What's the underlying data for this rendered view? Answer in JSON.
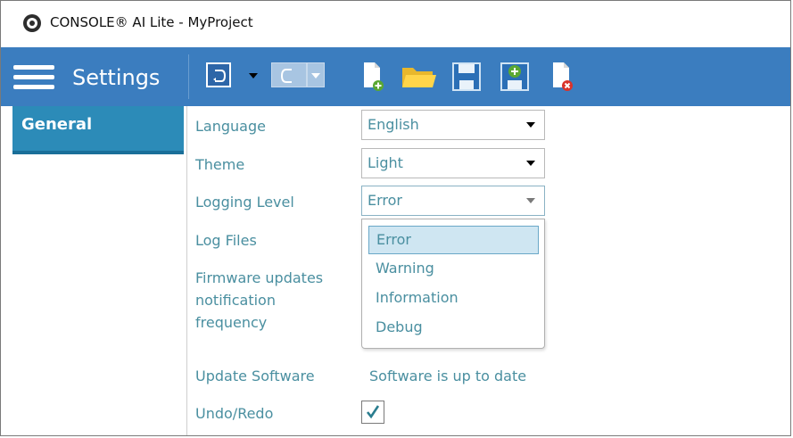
{
  "window": {
    "title": "CONSOLE® AI Lite - MyProject",
    "logo_icon": "app-logo-icon"
  },
  "toolbar": {
    "title": "Settings",
    "background": "#3b7dbf",
    "buttons": [
      {
        "name": "undo",
        "icon": "undo-icon",
        "has_dropdown": true,
        "enabled": true
      },
      {
        "name": "redo",
        "icon": "redo-icon",
        "has_dropdown": true,
        "enabled": false
      },
      {
        "name": "new-file",
        "icon": "new-file-icon"
      },
      {
        "name": "open-folder",
        "icon": "folder-open-icon"
      },
      {
        "name": "save",
        "icon": "save-icon"
      },
      {
        "name": "save-as",
        "icon": "save-as-icon"
      },
      {
        "name": "close-file",
        "icon": "close-file-icon"
      }
    ]
  },
  "sidebar": {
    "items": [
      {
        "label": "General",
        "selected": true
      }
    ]
  },
  "settings": {
    "language": {
      "label": "Language",
      "value": "English"
    },
    "theme": {
      "label": "Theme",
      "value": "Light"
    },
    "logging_level": {
      "label": "Logging Level",
      "value": "Error",
      "options": [
        "Error",
        "Warning",
        "Information",
        "Debug"
      ],
      "highlighted": "Error"
    },
    "log_files": {
      "label": "Log Files"
    },
    "firmware_notification": {
      "label_lines": [
        "Firmware updates",
        "notification",
        "frequency"
      ]
    },
    "update_software": {
      "label": "Update Software",
      "value": "Software is up to date"
    },
    "undo_redo": {
      "label": "Undo/Redo",
      "checked": true
    }
  }
}
